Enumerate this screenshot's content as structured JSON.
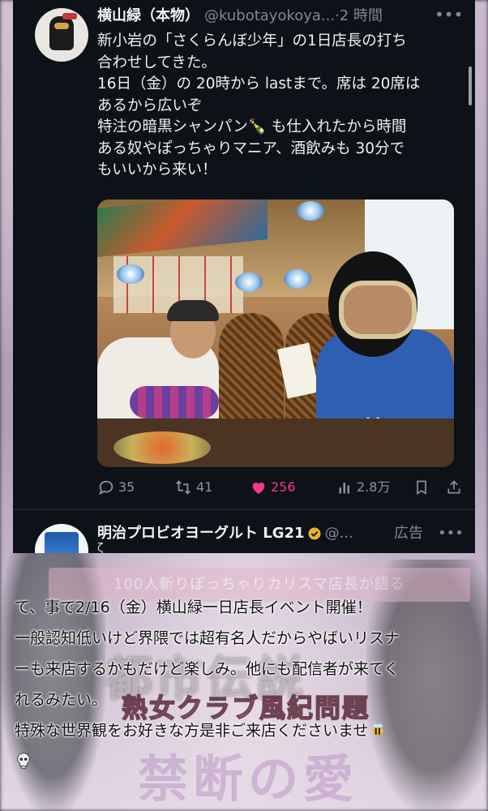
{
  "tweet": {
    "display_name": "横山緑（本物）",
    "handle": "@kubotayokoya...",
    "time": "·2 時間",
    "body_lines": [
      "新小岩の「さくらんぼ少年」の1日店長の打ち",
      "合わせしてきた。",
      "16日（金）の 20時から lastまで。席は 20席は",
      "あるから広いぞ",
      "特注の暗黒シャンパン🍾 も仕入れたから時間",
      "ある奴やぽっちゃりマニア、酒飲みも 30分で",
      "もいいから来い！"
    ],
    "metrics": {
      "replies": "35",
      "retweets": "41",
      "likes": "256",
      "views": "2.8万"
    },
    "colors": {
      "like": "#f0398a",
      "text": "#eef0f2",
      "muted": "#7f8893"
    }
  },
  "ad_tweet": {
    "display_name": "明治プロビオヨーグルト LG21",
    "handle": "@...",
    "label": "広告",
    "cut_text": "ζ"
  },
  "background": {
    "banner": "100人斬りぽっちゃりカリスマ店長が語る",
    "title_blur": "都市伝説",
    "subtitle": "熟女クラブ風紀問題",
    "big": "禁断の愛"
  },
  "caption": {
    "lines": [
      "て、事で2/16（金）横山緑一日店長イベント開催！",
      "一般認知低いけど界隈では超有名人だからやばいリスナ",
      "ーも来店するかもだけど楽しみ。他にも配信者が来てく",
      "れるみたい。",
      "特殊な世界観をお好きな方是非ご来店くださいませ"
    ]
  }
}
